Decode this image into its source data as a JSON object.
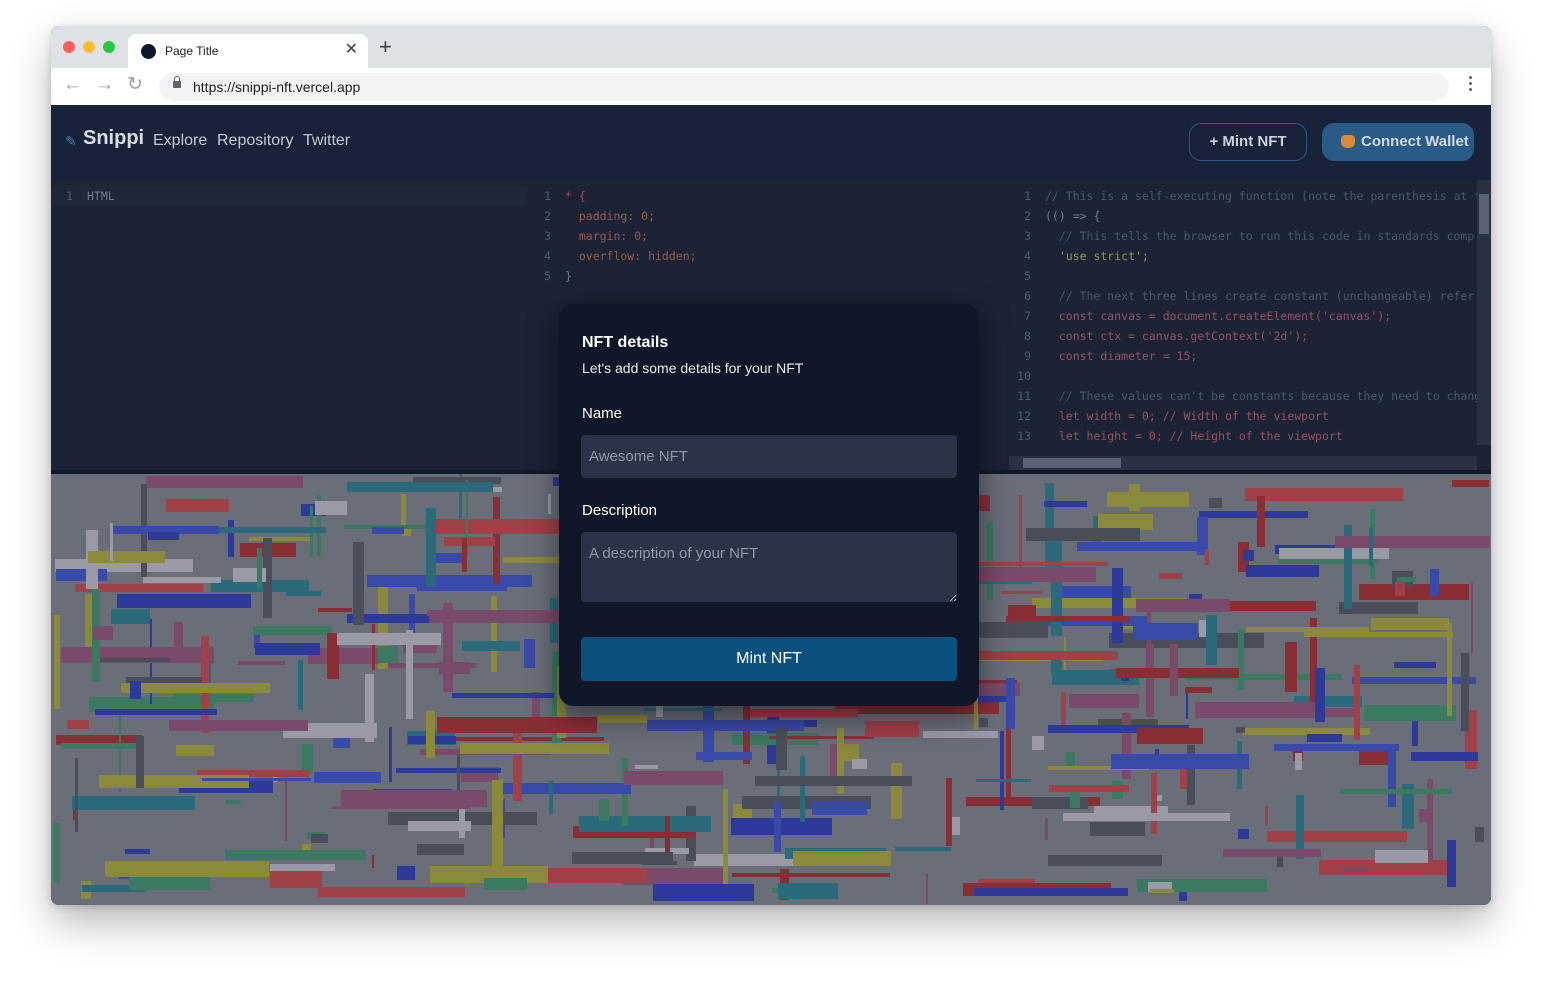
{
  "browser": {
    "tab_title": "Page Title",
    "url": "https://snippi-nft.vercel.app"
  },
  "nav": {
    "brand": "Snippi",
    "links": [
      "Explore",
      "Repository",
      "Twitter"
    ],
    "mint_button": "+ Mint NFT",
    "connect_button": "Connect Wallet"
  },
  "editors": {
    "html": [
      "HTML"
    ],
    "css": [
      "* {",
      "  padding: 0;",
      "  margin: 0;",
      "  overflow: hidden;",
      "}"
    ],
    "js": [
      "// This is a self-executing function (note the parenthesis at th",
      "(() => {",
      "  // This tells the browser to run this code in standards comp",
      "  'use strict';",
      "",
      "  // The next three lines create constant (unchangeable) refer",
      "  const canvas = document.createElement('canvas');",
      "  const ctx = canvas.getContext('2d');",
      "  const diameter = 15;",
      "",
      "  // These values can't be constants because they need to chang",
      "  let width = 0; // Width of the viewport",
      "  let height = 0; // Height of the viewport"
    ]
  },
  "modal": {
    "title": "NFT details",
    "subtitle": "Let's add some details for your NFT",
    "name_label": "Name",
    "name_placeholder": "Awesome NFT",
    "description_label": "Description",
    "description_placeholder": "A description of your NFT",
    "submit_label": "Mint NFT"
  },
  "colors": {
    "app_bg": "#0f1728",
    "accent": "#0c5080",
    "connect_bg": "#2a5a86"
  }
}
